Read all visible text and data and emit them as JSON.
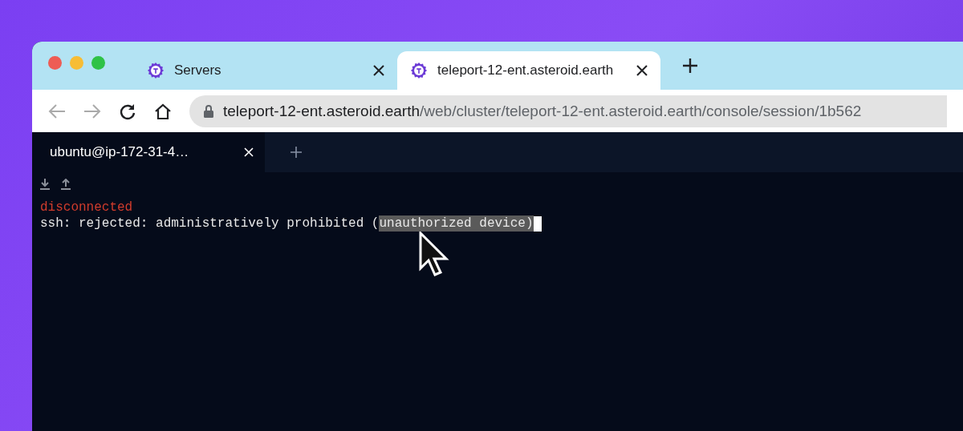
{
  "browser": {
    "tabs": [
      {
        "label": "Servers",
        "selected": false
      },
      {
        "label": "teleport-12-ent.asteroid.earth",
        "selected": true
      }
    ],
    "address": {
      "host": "teleport-12-ent.asteroid.earth",
      "path": "/web/cluster/teleport-12-ent.asteroid.earth/console/session/1b562"
    }
  },
  "terminal": {
    "tabs": [
      {
        "label": "ubuntu@ip-172-31-4…",
        "selected": true
      }
    ],
    "lines": [
      {
        "kind": "error",
        "segments": [
          {
            "text": "disconnected",
            "selected": false
          }
        ]
      },
      {
        "kind": "output",
        "segments": [
          {
            "text": "ssh: rejected: administratively prohibited (",
            "selected": false
          },
          {
            "text": "unauthorized device)",
            "selected": true
          }
        ],
        "cursor": true
      }
    ]
  }
}
